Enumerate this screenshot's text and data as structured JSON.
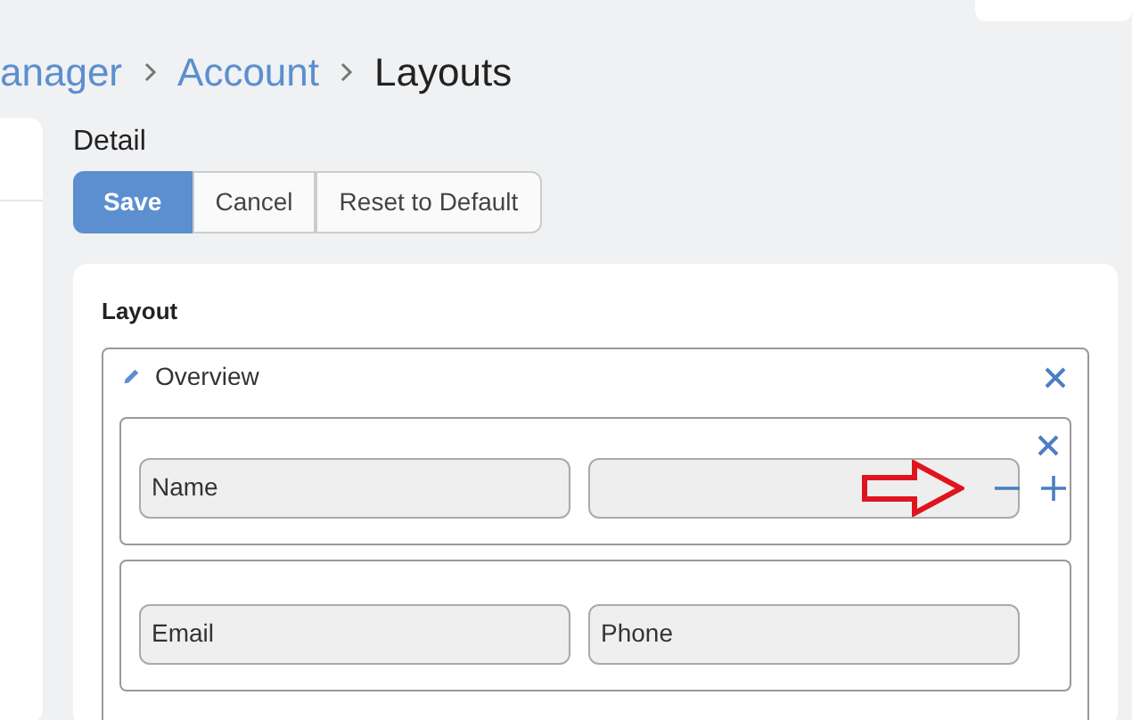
{
  "breadcrumb": [
    {
      "label": "anager",
      "kind": "link"
    },
    {
      "label": "Account",
      "kind": "link"
    },
    {
      "label": "Layouts",
      "kind": "current"
    }
  ],
  "heading": "Detail",
  "buttons": [
    {
      "label": "Save",
      "kind": "primary"
    },
    {
      "label": "Cancel",
      "kind": "default"
    },
    {
      "label": "Reset to Default",
      "kind": "default"
    }
  ],
  "card_title": "Layout",
  "panel": {
    "title": "Overview",
    "rows": [
      {
        "controls_shown": true,
        "annotated": true,
        "cells": [
          {
            "label": "Name"
          },
          {
            "empty": true
          }
        ]
      },
      {
        "controls_shown": false,
        "annotated": false,
        "cells": [
          {
            "label": "Email"
          },
          {
            "label": "Phone"
          }
        ]
      }
    ]
  }
}
